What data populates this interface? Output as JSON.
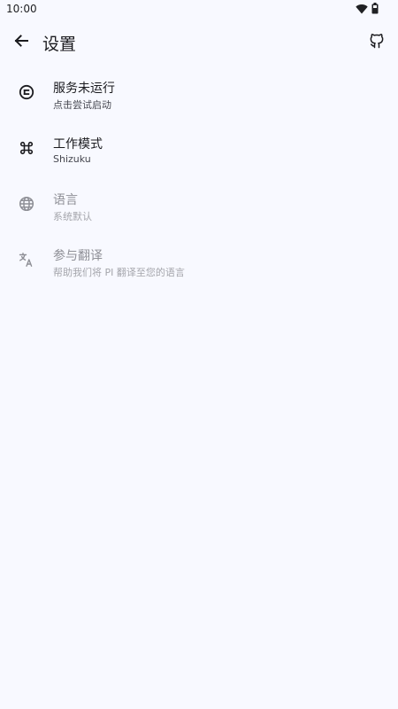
{
  "status_bar": {
    "time": "10:00",
    "icons": [
      "wifi-icon",
      "battery-icon"
    ]
  },
  "appbar": {
    "title": "设置",
    "back_icon": "arrow-back-icon",
    "action_icon": "github-icon"
  },
  "settings": [
    {
      "title": "服务未运行",
      "subtitle": "点击尝试启动",
      "icon": "service-icon",
      "enabled": true
    },
    {
      "title": "工作模式",
      "subtitle": "Shizuku",
      "icon": "command-icon",
      "enabled": true
    },
    {
      "title": "语言",
      "subtitle": "系统默认",
      "icon": "globe-icon",
      "enabled": false
    },
    {
      "title": "参与翻译",
      "subtitle": "帮助我们将 PI 翻译至您的语言",
      "icon": "translate-icon",
      "enabled": false
    }
  ],
  "colors": {
    "background": "#f8f9ff",
    "text_primary": "#1b1b1f",
    "text_secondary": "#45464f",
    "text_disabled": "#8e8f96"
  }
}
